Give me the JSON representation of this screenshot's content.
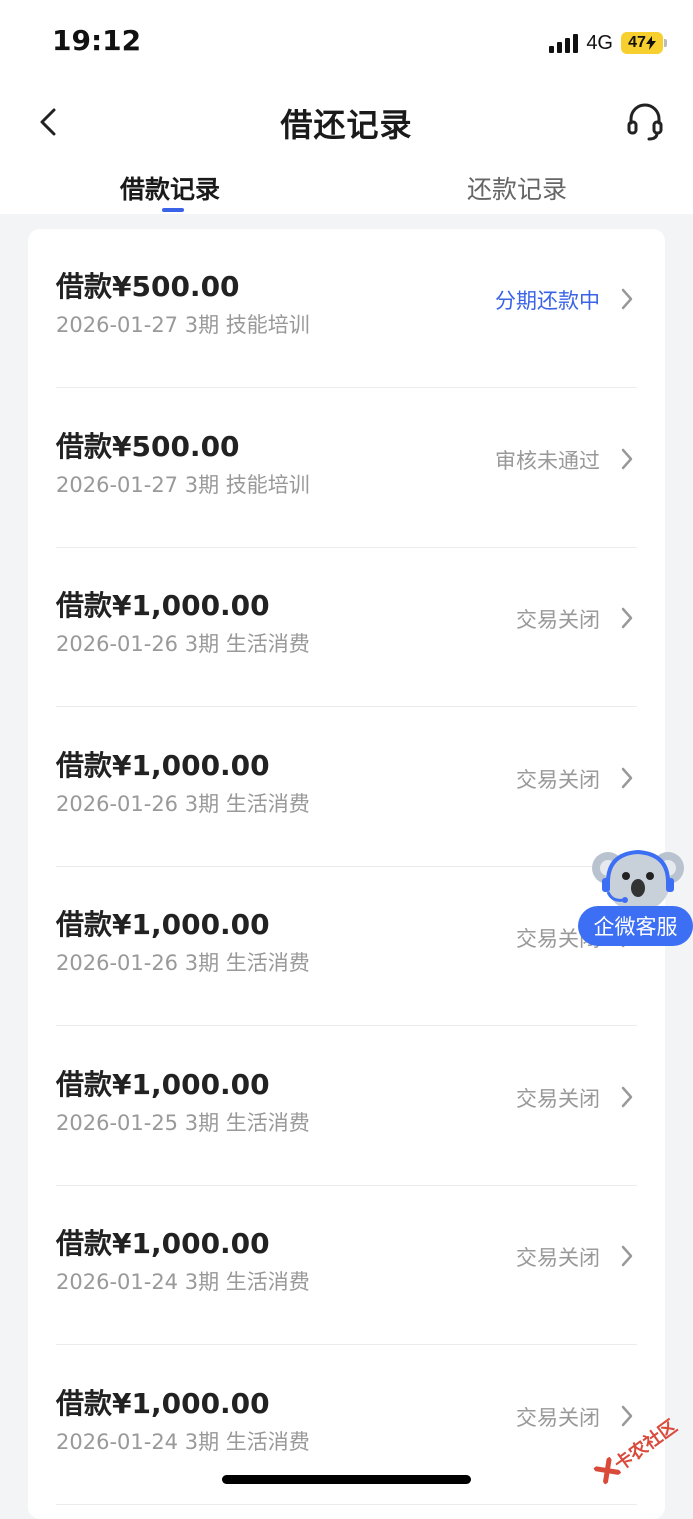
{
  "status_bar": {
    "time": "19:12",
    "network": "4G",
    "battery": "47"
  },
  "header": {
    "title": "借还记录"
  },
  "tabs": [
    {
      "label": "借款记录",
      "active": true
    },
    {
      "label": "还款记录",
      "active": false
    }
  ],
  "records": [
    {
      "amount": "借款¥500.00",
      "meta": "2026-01-27 3期  技能培训",
      "status": "分期还款中",
      "status_color": "#3a63e8"
    },
    {
      "amount": "借款¥500.00",
      "meta": "2026-01-27 3期  技能培训",
      "status": "审核未通过",
      "status_color": "#999999"
    },
    {
      "amount": "借款¥1,000.00",
      "meta": "2026-01-26 3期  生活消费",
      "status": "交易关闭",
      "status_color": "#999999"
    },
    {
      "amount": "借款¥1,000.00",
      "meta": "2026-01-26 3期  生活消费",
      "status": "交易关闭",
      "status_color": "#999999"
    },
    {
      "amount": "借款¥1,000.00",
      "meta": "2026-01-26 3期  生活消费",
      "status": "交易关闭",
      "status_color": "#999999"
    },
    {
      "amount": "借款¥1,000.00",
      "meta": "2026-01-25 3期  生活消费",
      "status": "交易关闭",
      "status_color": "#999999"
    },
    {
      "amount": "借款¥1,000.00",
      "meta": "2026-01-24 3期  生活消费",
      "status": "交易关闭",
      "status_color": "#999999"
    },
    {
      "amount": "借款¥1,000.00",
      "meta": "2026-01-24 3期  生活消费",
      "status": "交易关闭",
      "status_color": "#999999"
    }
  ],
  "floating_service": {
    "label": "企微客服",
    "icon": "koala-headset-icon"
  },
  "watermark": {
    "text": "卡农社区"
  },
  "colors": {
    "accent": "#3a63e8",
    "background": "#f3f4f6",
    "card": "#ffffff"
  }
}
